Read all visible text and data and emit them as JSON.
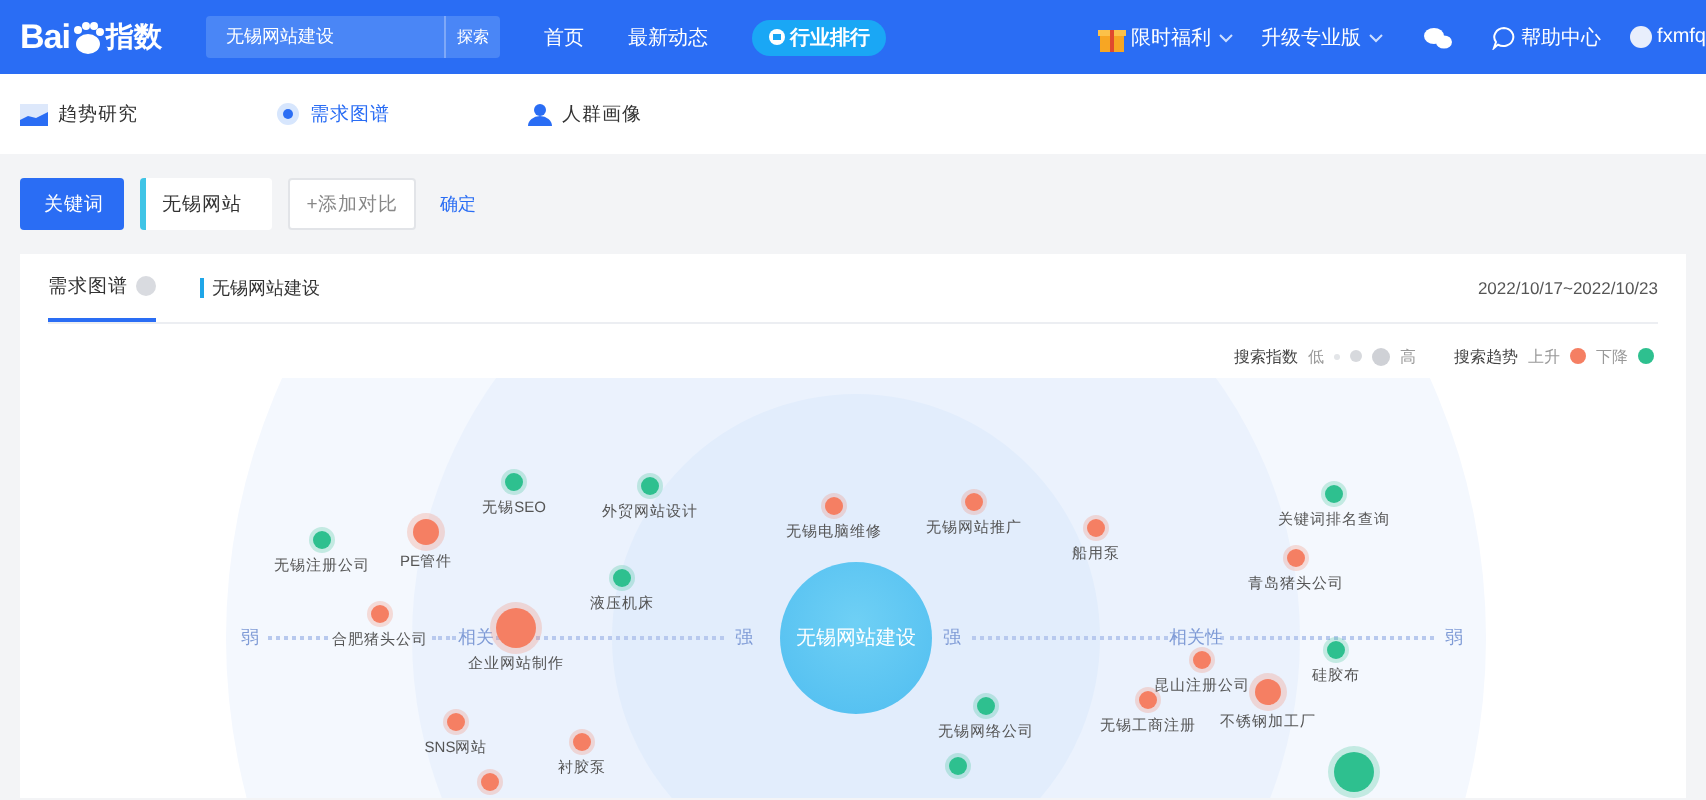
{
  "header": {
    "logo_text": "Bai",
    "logo_suffix": "指数",
    "search": {
      "value": "无锡网站建设",
      "button": "探索"
    },
    "nav": [
      {
        "label": "首页"
      },
      {
        "label": "最新动态"
      }
    ],
    "ranking_button": "行业排行",
    "menus": [
      {
        "label": "限时福利",
        "kind": "gift"
      },
      {
        "label": "升级专业版",
        "kind": "plain"
      }
    ],
    "help": "帮助中心",
    "user": "fxmfq"
  },
  "subnav": [
    {
      "label": "趋势研究",
      "kind": "chart",
      "selected": false
    },
    {
      "label": "需求图谱",
      "kind": "dot",
      "selected": true
    },
    {
      "label": "人群画像",
      "kind": "person",
      "selected": false
    }
  ],
  "toolbar": {
    "keyword_button": "关键词",
    "keyword": "无锡网站",
    "add_button": "+添加对比",
    "confirm": "确定"
  },
  "card": {
    "tabs": [
      {
        "label": "需求图谱",
        "selected": true
      }
    ],
    "keyword": "无锡网站建设",
    "date_range": "2022/10/17~2022/10/23",
    "legend": {
      "index_label": "搜索指数",
      "low": "低",
      "high": "高",
      "trend_label": "搜索趋势",
      "up": "上升",
      "down": "下降"
    }
  },
  "graph": {
    "center": "无锡网站建设",
    "axis": [
      "弱",
      "相关",
      "强",
      "强",
      "相关性",
      "弱"
    ],
    "nodes": [
      {
        "label": "无锡SEO",
        "color": "#2ec08f",
        "kind": "small"
      },
      {
        "label": "外贸网站设计",
        "color": "#2ec08f",
        "kind": "small"
      },
      {
        "label": "无锡电脑维修",
        "color": "#f57f63",
        "kind": "small"
      },
      {
        "label": "无锡网站推广",
        "color": "#f57f63",
        "kind": "small"
      },
      {
        "label": "船用泵",
        "color": "#f57f63",
        "kind": "small"
      },
      {
        "label": "关键词排名查询",
        "color": "#2ec08f",
        "kind": "small"
      },
      {
        "label": "无锡注册公司",
        "color": "#2ec08f",
        "kind": "small"
      },
      {
        "label": "PE管件",
        "color": "#f57f63",
        "kind": "medium"
      },
      {
        "label": "青岛猪头公司",
        "color": "#f57f63",
        "kind": "small"
      },
      {
        "label": "液压机床",
        "color": "#2ec08f",
        "kind": "small"
      },
      {
        "label": "合肥猪头公司",
        "color": "#f57f63",
        "kind": "small"
      },
      {
        "label": "企业网站制作",
        "color": "#f57f63",
        "kind": "large"
      },
      {
        "label": "硅胶布",
        "color": "#2ec08f",
        "kind": "small"
      },
      {
        "label": "昆山注册公司",
        "color": "#f57f63",
        "kind": "small"
      },
      {
        "label": "无锡工商注册",
        "color": "#f57f63",
        "kind": "small"
      },
      {
        "label": "不锈钢加工厂",
        "color": "#f57f63",
        "kind": "medium"
      },
      {
        "label": "无锡网络公司",
        "color": "#2ec08f",
        "kind": "small"
      },
      {
        "label": "SNS网站",
        "color": "#f57f63",
        "kind": "small"
      },
      {
        "label": "衬胶泵",
        "color": "#f57f63",
        "kind": "small"
      },
      {
        "color": "#f57f63",
        "kind": "small"
      },
      {
        "color": "#2ec08f",
        "kind": "small"
      },
      {
        "color": "#2ec08f",
        "kind": "large"
      }
    ]
  }
}
